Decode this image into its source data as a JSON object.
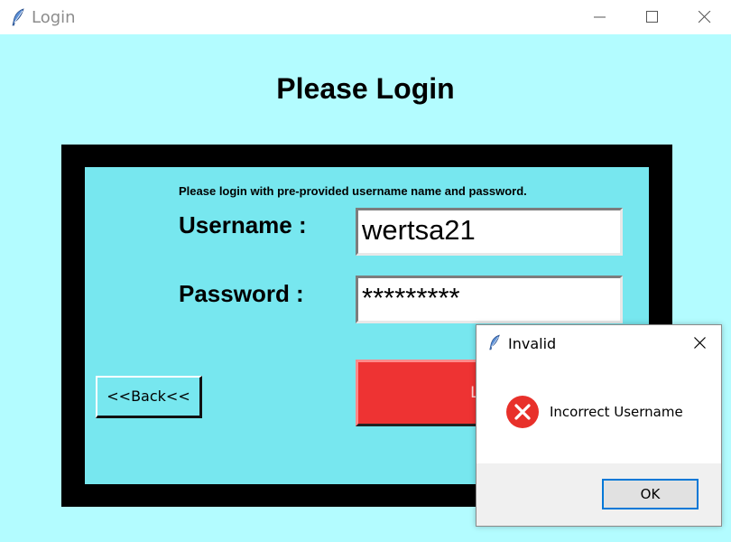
{
  "window": {
    "title": "Login",
    "icon": "feather-icon",
    "background_color": "#b3fcff"
  },
  "form": {
    "heading": "Please Login",
    "instructions": "Please login with pre-provided username name and password.",
    "username_label": "Username :",
    "username_value": "wertsa21",
    "password_label": "Password :",
    "password_value": "*********",
    "back_button": "<<Back<<",
    "login_button": "Login",
    "panel_color": "#77e7ef",
    "login_button_color": "#ee3333"
  },
  "dialog": {
    "title": "Invalid",
    "icon": "feather-icon",
    "message": "Incorrect Username",
    "status_icon": "error-icon",
    "ok_button": "OK",
    "accent_color": "#0078d7"
  }
}
